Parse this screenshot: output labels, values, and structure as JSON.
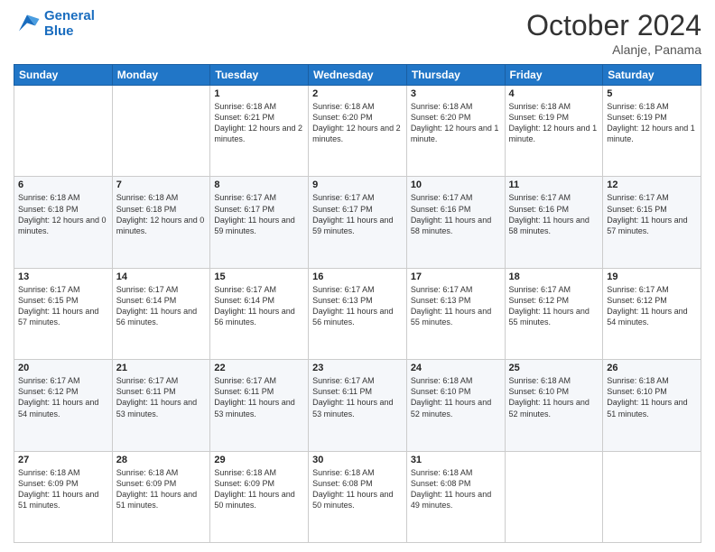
{
  "header": {
    "logo_line1": "General",
    "logo_line2": "Blue",
    "month": "October 2024",
    "location": "Alanje, Panama"
  },
  "weekdays": [
    "Sunday",
    "Monday",
    "Tuesday",
    "Wednesday",
    "Thursday",
    "Friday",
    "Saturday"
  ],
  "weeks": [
    [
      {
        "day": "",
        "sunrise": "",
        "sunset": "",
        "daylight": ""
      },
      {
        "day": "",
        "sunrise": "",
        "sunset": "",
        "daylight": ""
      },
      {
        "day": "1",
        "sunrise": "Sunrise: 6:18 AM",
        "sunset": "Sunset: 6:21 PM",
        "daylight": "Daylight: 12 hours and 2 minutes."
      },
      {
        "day": "2",
        "sunrise": "Sunrise: 6:18 AM",
        "sunset": "Sunset: 6:20 PM",
        "daylight": "Daylight: 12 hours and 2 minutes."
      },
      {
        "day": "3",
        "sunrise": "Sunrise: 6:18 AM",
        "sunset": "Sunset: 6:20 PM",
        "daylight": "Daylight: 12 hours and 1 minute."
      },
      {
        "day": "4",
        "sunrise": "Sunrise: 6:18 AM",
        "sunset": "Sunset: 6:19 PM",
        "daylight": "Daylight: 12 hours and 1 minute."
      },
      {
        "day": "5",
        "sunrise": "Sunrise: 6:18 AM",
        "sunset": "Sunset: 6:19 PM",
        "daylight": "Daylight: 12 hours and 1 minute."
      }
    ],
    [
      {
        "day": "6",
        "sunrise": "Sunrise: 6:18 AM",
        "sunset": "Sunset: 6:18 PM",
        "daylight": "Daylight: 12 hours and 0 minutes."
      },
      {
        "day": "7",
        "sunrise": "Sunrise: 6:18 AM",
        "sunset": "Sunset: 6:18 PM",
        "daylight": "Daylight: 12 hours and 0 minutes."
      },
      {
        "day": "8",
        "sunrise": "Sunrise: 6:17 AM",
        "sunset": "Sunset: 6:17 PM",
        "daylight": "Daylight: 11 hours and 59 minutes."
      },
      {
        "day": "9",
        "sunrise": "Sunrise: 6:17 AM",
        "sunset": "Sunset: 6:17 PM",
        "daylight": "Daylight: 11 hours and 59 minutes."
      },
      {
        "day": "10",
        "sunrise": "Sunrise: 6:17 AM",
        "sunset": "Sunset: 6:16 PM",
        "daylight": "Daylight: 11 hours and 58 minutes."
      },
      {
        "day": "11",
        "sunrise": "Sunrise: 6:17 AM",
        "sunset": "Sunset: 6:16 PM",
        "daylight": "Daylight: 11 hours and 58 minutes."
      },
      {
        "day": "12",
        "sunrise": "Sunrise: 6:17 AM",
        "sunset": "Sunset: 6:15 PM",
        "daylight": "Daylight: 11 hours and 57 minutes."
      }
    ],
    [
      {
        "day": "13",
        "sunrise": "Sunrise: 6:17 AM",
        "sunset": "Sunset: 6:15 PM",
        "daylight": "Daylight: 11 hours and 57 minutes."
      },
      {
        "day": "14",
        "sunrise": "Sunrise: 6:17 AM",
        "sunset": "Sunset: 6:14 PM",
        "daylight": "Daylight: 11 hours and 56 minutes."
      },
      {
        "day": "15",
        "sunrise": "Sunrise: 6:17 AM",
        "sunset": "Sunset: 6:14 PM",
        "daylight": "Daylight: 11 hours and 56 minutes."
      },
      {
        "day": "16",
        "sunrise": "Sunrise: 6:17 AM",
        "sunset": "Sunset: 6:13 PM",
        "daylight": "Daylight: 11 hours and 56 minutes."
      },
      {
        "day": "17",
        "sunrise": "Sunrise: 6:17 AM",
        "sunset": "Sunset: 6:13 PM",
        "daylight": "Daylight: 11 hours and 55 minutes."
      },
      {
        "day": "18",
        "sunrise": "Sunrise: 6:17 AM",
        "sunset": "Sunset: 6:12 PM",
        "daylight": "Daylight: 11 hours and 55 minutes."
      },
      {
        "day": "19",
        "sunrise": "Sunrise: 6:17 AM",
        "sunset": "Sunset: 6:12 PM",
        "daylight": "Daylight: 11 hours and 54 minutes."
      }
    ],
    [
      {
        "day": "20",
        "sunrise": "Sunrise: 6:17 AM",
        "sunset": "Sunset: 6:12 PM",
        "daylight": "Daylight: 11 hours and 54 minutes."
      },
      {
        "day": "21",
        "sunrise": "Sunrise: 6:17 AM",
        "sunset": "Sunset: 6:11 PM",
        "daylight": "Daylight: 11 hours and 53 minutes."
      },
      {
        "day": "22",
        "sunrise": "Sunrise: 6:17 AM",
        "sunset": "Sunset: 6:11 PM",
        "daylight": "Daylight: 11 hours and 53 minutes."
      },
      {
        "day": "23",
        "sunrise": "Sunrise: 6:17 AM",
        "sunset": "Sunset: 6:11 PM",
        "daylight": "Daylight: 11 hours and 53 minutes."
      },
      {
        "day": "24",
        "sunrise": "Sunrise: 6:18 AM",
        "sunset": "Sunset: 6:10 PM",
        "daylight": "Daylight: 11 hours and 52 minutes."
      },
      {
        "day": "25",
        "sunrise": "Sunrise: 6:18 AM",
        "sunset": "Sunset: 6:10 PM",
        "daylight": "Daylight: 11 hours and 52 minutes."
      },
      {
        "day": "26",
        "sunrise": "Sunrise: 6:18 AM",
        "sunset": "Sunset: 6:10 PM",
        "daylight": "Daylight: 11 hours and 51 minutes."
      }
    ],
    [
      {
        "day": "27",
        "sunrise": "Sunrise: 6:18 AM",
        "sunset": "Sunset: 6:09 PM",
        "daylight": "Daylight: 11 hours and 51 minutes."
      },
      {
        "day": "28",
        "sunrise": "Sunrise: 6:18 AM",
        "sunset": "Sunset: 6:09 PM",
        "daylight": "Daylight: 11 hours and 51 minutes."
      },
      {
        "day": "29",
        "sunrise": "Sunrise: 6:18 AM",
        "sunset": "Sunset: 6:09 PM",
        "daylight": "Daylight: 11 hours and 50 minutes."
      },
      {
        "day": "30",
        "sunrise": "Sunrise: 6:18 AM",
        "sunset": "Sunset: 6:08 PM",
        "daylight": "Daylight: 11 hours and 50 minutes."
      },
      {
        "day": "31",
        "sunrise": "Sunrise: 6:18 AM",
        "sunset": "Sunset: 6:08 PM",
        "daylight": "Daylight: 11 hours and 49 minutes."
      },
      {
        "day": "",
        "sunrise": "",
        "sunset": "",
        "daylight": ""
      },
      {
        "day": "",
        "sunrise": "",
        "sunset": "",
        "daylight": ""
      }
    ]
  ]
}
